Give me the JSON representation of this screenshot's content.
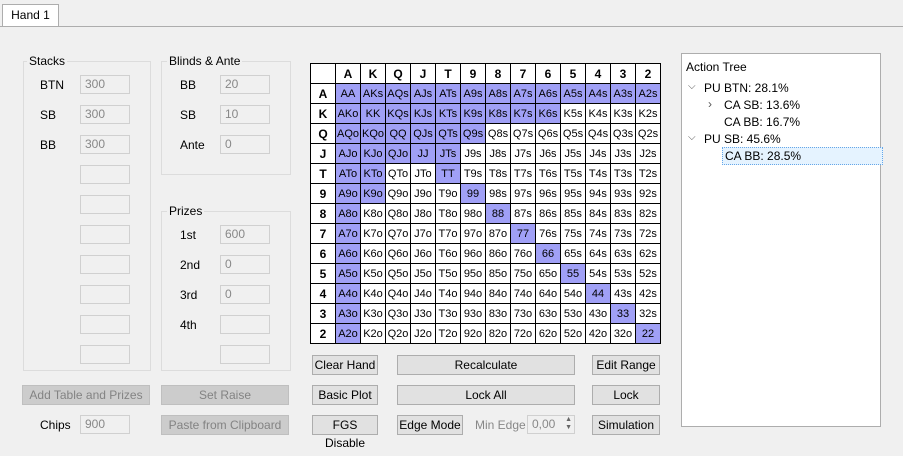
{
  "tab": {
    "label": "Hand 1"
  },
  "stacks": {
    "title": "Stacks",
    "rows": [
      {
        "label": "BTN",
        "value": "300"
      },
      {
        "label": "SB",
        "value": "300"
      },
      {
        "label": "BB",
        "value": "300"
      }
    ]
  },
  "blinds": {
    "title": "Blinds & Ante",
    "rows": [
      {
        "label": "BB",
        "value": "20"
      },
      {
        "label": "SB",
        "value": "10"
      },
      {
        "label": "Ante",
        "value": "0"
      }
    ]
  },
  "prizes": {
    "title": "Prizes",
    "rows": [
      {
        "label": "1st",
        "value": "600"
      },
      {
        "label": "2nd",
        "value": "0"
      },
      {
        "label": "3rd",
        "value": "0"
      },
      {
        "label": "4th",
        "value": ""
      }
    ]
  },
  "buttons": {
    "add_table": "Add Table and Prizes",
    "set_raise": "Set Raise",
    "paste": "Paste from Clipboard",
    "clear_hand": "Clear Hand",
    "recalculate": "Recalculate",
    "edit_range": "Edit Range",
    "basic_plot": "Basic Plot",
    "lock_all": "Lock All",
    "lock": "Lock",
    "fgs_disable": "FGS Disable",
    "edge_mode": "Edge Mode",
    "simulation": "Simulation"
  },
  "chips": {
    "label": "Chips",
    "value": "900"
  },
  "min_edge": {
    "label": "Min Edge",
    "value": "0,00"
  },
  "ranks": [
    "A",
    "K",
    "Q",
    "J",
    "T",
    "9",
    "8",
    "7",
    "6",
    "5",
    "4",
    "3",
    "2"
  ],
  "highlight_color": "#a0a0f6",
  "matrix_highlight": [
    [
      1,
      1,
      1,
      1,
      1,
      1,
      1,
      1,
      1,
      1,
      1,
      1,
      1
    ],
    [
      1,
      1,
      1,
      1,
      1,
      1,
      1,
      1,
      1,
      0,
      0,
      0,
      0
    ],
    [
      1,
      1,
      1,
      1,
      1,
      1,
      0,
      0,
      0,
      0,
      0,
      0,
      0
    ],
    [
      1,
      1,
      1,
      1,
      1,
      0,
      0,
      0,
      0,
      0,
      0,
      0,
      0
    ],
    [
      1,
      1,
      0,
      0,
      1,
      0,
      0,
      0,
      0,
      0,
      0,
      0,
      0
    ],
    [
      1,
      1,
      0,
      0,
      0,
      1,
      0,
      0,
      0,
      0,
      0,
      0,
      0
    ],
    [
      1,
      0,
      0,
      0,
      0,
      0,
      1,
      0,
      0,
      0,
      0,
      0,
      0
    ],
    [
      1,
      0,
      0,
      0,
      0,
      0,
      0,
      1,
      0,
      0,
      0,
      0,
      0
    ],
    [
      1,
      0,
      0,
      0,
      0,
      0,
      0,
      0,
      1,
      0,
      0,
      0,
      0
    ],
    [
      1,
      0,
      0,
      0,
      0,
      0,
      0,
      0,
      0,
      1,
      0,
      0,
      0
    ],
    [
      1,
      0,
      0,
      0,
      0,
      0,
      0,
      0,
      0,
      0,
      1,
      0,
      0
    ],
    [
      1,
      0,
      0,
      0,
      0,
      0,
      0,
      0,
      0,
      0,
      0,
      1,
      0
    ],
    [
      1,
      0,
      0,
      0,
      0,
      0,
      0,
      0,
      0,
      0,
      0,
      0,
      1
    ]
  ],
  "action_tree": {
    "title": "Action Tree",
    "nodes": [
      {
        "label": "PU BTN: 28.1%",
        "arrow": "expanded"
      },
      {
        "label": "CA SB: 13.6%",
        "arrow": "collapsed"
      },
      {
        "label": "CA BB: 16.7%",
        "arrow": "none"
      },
      {
        "label": "PU SB: 45.6%",
        "arrow": "expanded"
      },
      {
        "label": "CA BB: 28.5%",
        "arrow": "none",
        "selected": true
      }
    ]
  }
}
